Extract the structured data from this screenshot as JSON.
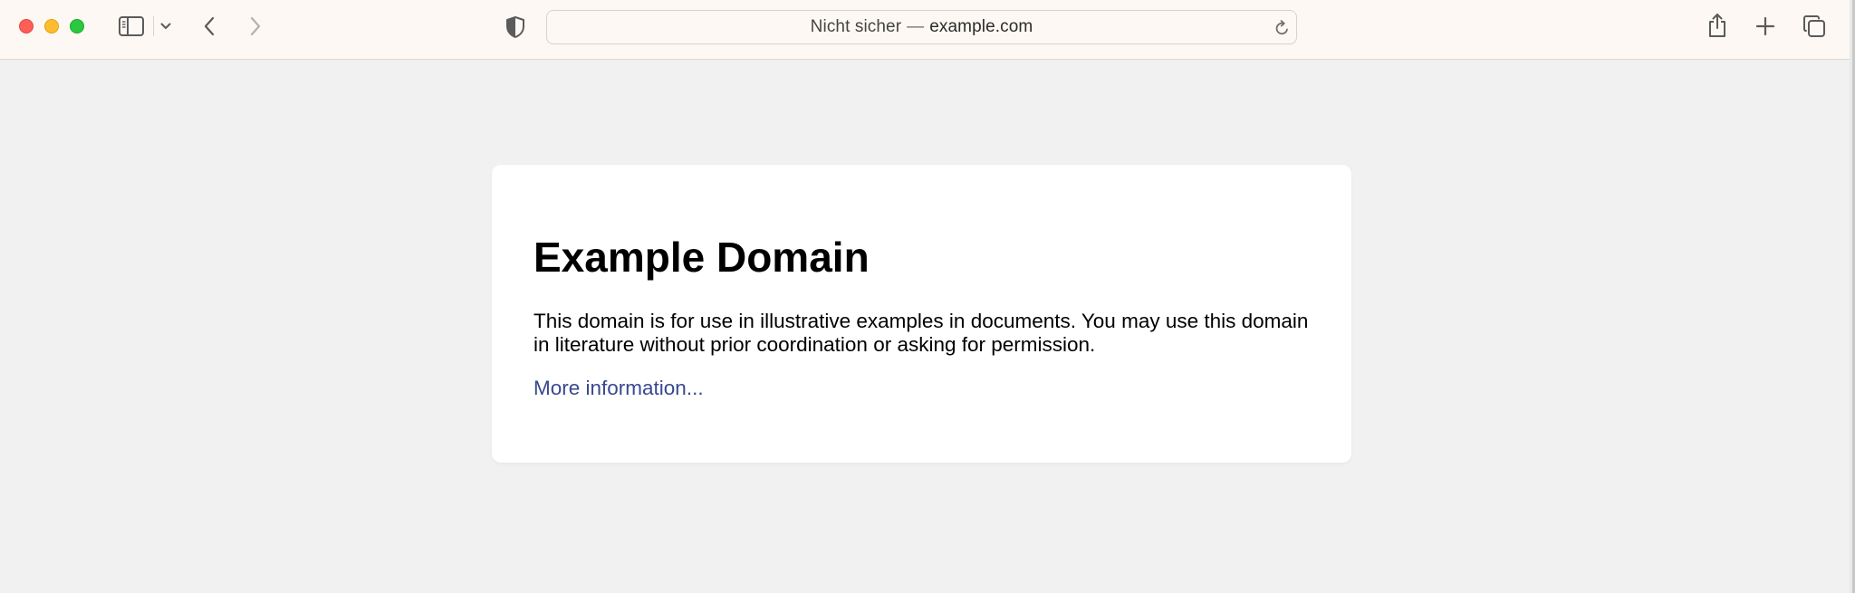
{
  "browser": {
    "address_bar": {
      "security_label": "Nicht sicher",
      "separator": "—",
      "host": "example.com"
    },
    "icons": {
      "close": "close-window-button",
      "minimize": "minimize-window-button",
      "maximize": "zoom-window-button",
      "sidebar": "sidebar-icon",
      "tab_group_menu": "chevron-down-icon",
      "back": "chevron-left-icon",
      "forward": "chevron-right-icon",
      "privacy": "shield-icon",
      "reload": "reload-icon",
      "share": "share-icon",
      "new_tab": "plus-icon",
      "tab_overview": "tabs-overview-icon"
    },
    "colors": {
      "toolbar_bg": "#fdf8f3",
      "page_bg": "#f1f1f2",
      "traffic_close": "#fe5f57",
      "traffic_minimize": "#febc2e",
      "traffic_maximize": "#28c840"
    }
  },
  "page": {
    "heading": "Example Domain",
    "body_text": "This domain is for use in illustrative examples in documents. You may use this domain in literature without prior coordination or asking for permission.",
    "link_text": "More information...",
    "colors": {
      "card_bg": "#ffffff",
      "link": "#38488f",
      "text": "#000000"
    }
  }
}
